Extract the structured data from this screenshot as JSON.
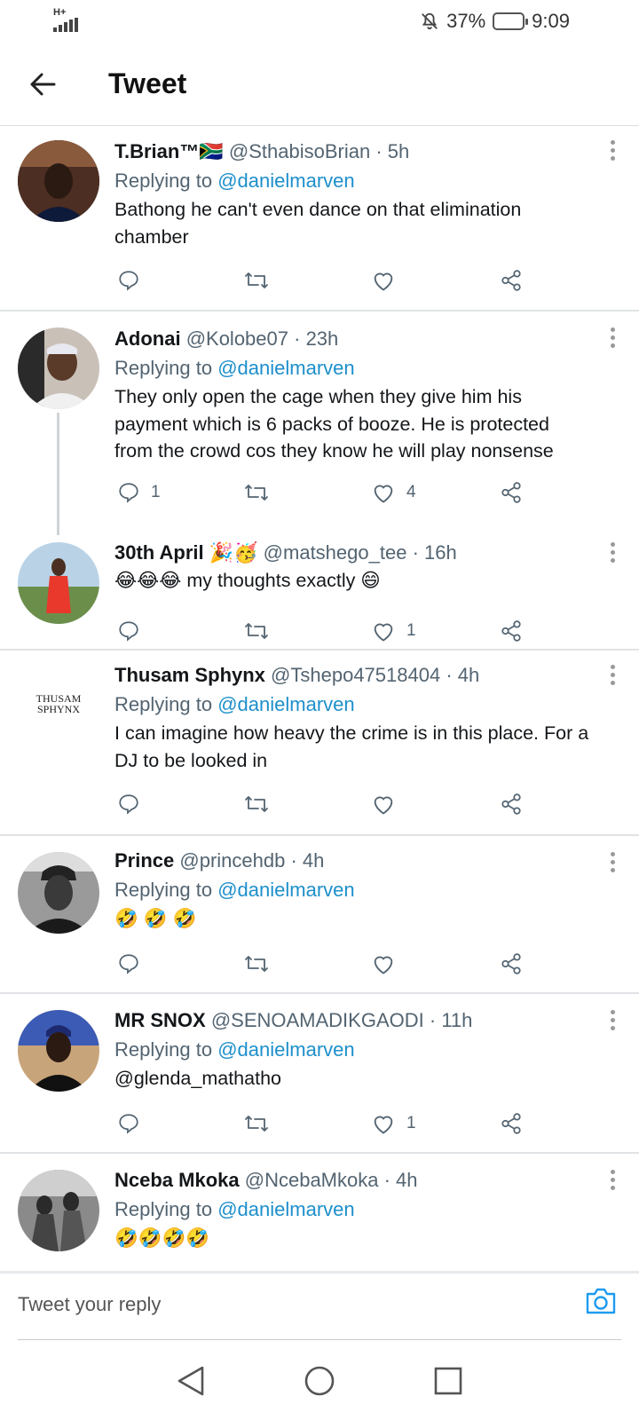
{
  "status": {
    "network": "H+",
    "battery_pct": "37%",
    "time": "9:09"
  },
  "header": {
    "title": "Tweet"
  },
  "tweets": [
    {
      "name": "T.Brian™🇿🇦",
      "handle": "@SthabisoBrian",
      "time": "· 5h",
      "replying_label": "Replying to",
      "replying_to": "@danielmarven",
      "text": "Bathong he can't even dance on that elimination chamber",
      "replies": "",
      "likes": ""
    },
    {
      "name": "Adonai",
      "handle": "@Kolobe07",
      "time": "· 23h",
      "replying_label": "Replying to",
      "replying_to": "@danielmarven",
      "text": "They only open the cage when they give him his payment which is 6 packs of booze. He is protected from the crowd cos they know he will play nonsense",
      "replies": "1",
      "likes": "4"
    },
    {
      "name": "30th April 🎉🥳",
      "handle": "@matshego_tee",
      "time": "· 16h",
      "text": "😂😂😂 my thoughts exactly 😄",
      "replies": "",
      "likes": "1"
    },
    {
      "name": "Thusam Sphynx",
      "handle": "@Tshepo47518404",
      "time": "· 4h",
      "replying_label": "Replying to",
      "replying_to": "@danielmarven",
      "text": "I can imagine how heavy the crime is in this place. For a DJ to be looked in",
      "avatar_text": "THUSAM SPHYNX",
      "replies": "",
      "likes": ""
    },
    {
      "name": "Prince",
      "handle": "@princehdb",
      "time": "· 4h",
      "replying_label": "Replying to",
      "replying_to": "@danielmarven",
      "text": "🤣 🤣 🤣",
      "replies": "",
      "likes": ""
    },
    {
      "name": "MR SNOX",
      "handle": "@SENOAMADIKGAODI",
      "time": "· 11h",
      "replying_label": "Replying to",
      "replying_to": "@danielmarven",
      "text": "@glenda_mathatho",
      "replies": "",
      "likes": "1"
    },
    {
      "name": "Nceba Mkoka",
      "handle": "@NcebaMkoka",
      "time": "· 4h",
      "replying_label": "Replying to",
      "replying_to": "@danielmarven",
      "text": "🤣🤣🤣🤣"
    }
  ],
  "reply_box": {
    "placeholder": "Tweet your reply"
  },
  "colors": {
    "accent": "#1d9bf0",
    "mention": "#1d8fcb",
    "icon": "#536471"
  }
}
